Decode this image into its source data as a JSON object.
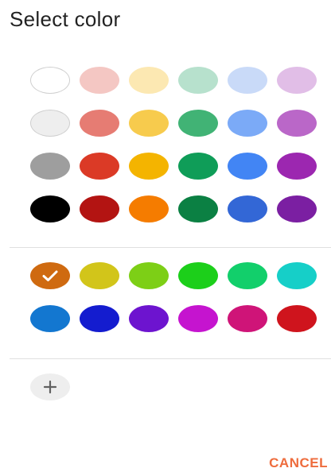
{
  "dialog": {
    "title": "Select color"
  },
  "preset_colors": [
    {
      "hex": "#ffffff",
      "outlined": true
    },
    {
      "hex": "#f4c7c3",
      "outlined": false
    },
    {
      "hex": "#fce8b2",
      "outlined": false
    },
    {
      "hex": "#b7e1cd",
      "outlined": false
    },
    {
      "hex": "#c9daf8",
      "outlined": false
    },
    {
      "hex": "#e1bee7",
      "outlined": false
    },
    {
      "hex": "#eeeeee",
      "outlined": true
    },
    {
      "hex": "#e67c73",
      "outlined": false
    },
    {
      "hex": "#f7cb4d",
      "outlined": false
    },
    {
      "hex": "#41b375",
      "outlined": false
    },
    {
      "hex": "#7baaf7",
      "outlined": false
    },
    {
      "hex": "#ba67c8",
      "outlined": false
    },
    {
      "hex": "#9e9e9e",
      "outlined": false
    },
    {
      "hex": "#db3a26",
      "outlined": false
    },
    {
      "hex": "#f4b400",
      "outlined": false
    },
    {
      "hex": "#0f9d58",
      "outlined": false
    },
    {
      "hex": "#4285f4",
      "outlined": false
    },
    {
      "hex": "#9c27b0",
      "outlined": false
    },
    {
      "hex": "#000000",
      "outlined": false
    },
    {
      "hex": "#b31412",
      "outlined": false
    },
    {
      "hex": "#f57c00",
      "outlined": false
    },
    {
      "hex": "#0b8043",
      "outlined": false
    },
    {
      "hex": "#3367d6",
      "outlined": false
    },
    {
      "hex": "#7b1fa2",
      "outlined": false
    }
  ],
  "custom_colors": [
    {
      "hex": "#cf6a10",
      "selected": true
    },
    {
      "hex": "#d2c51a",
      "selected": false
    },
    {
      "hex": "#7dcf16",
      "selected": false
    },
    {
      "hex": "#1ccf1a",
      "selected": false
    },
    {
      "hex": "#12cf6b",
      "selected": false
    },
    {
      "hex": "#16cfc8",
      "selected": false
    },
    {
      "hex": "#1377d0",
      "selected": false
    },
    {
      "hex": "#141ccf",
      "selected": false
    },
    {
      "hex": "#6d14cf",
      "selected": false
    },
    {
      "hex": "#c514cf",
      "selected": false
    },
    {
      "hex": "#cf1478",
      "selected": false
    },
    {
      "hex": "#cf141d",
      "selected": false
    }
  ],
  "icons": {
    "check": "check-icon",
    "add": "plus-icon"
  },
  "actions": {
    "cancel_label": "CANCEL",
    "cancel_color": "#ee6c3d"
  }
}
